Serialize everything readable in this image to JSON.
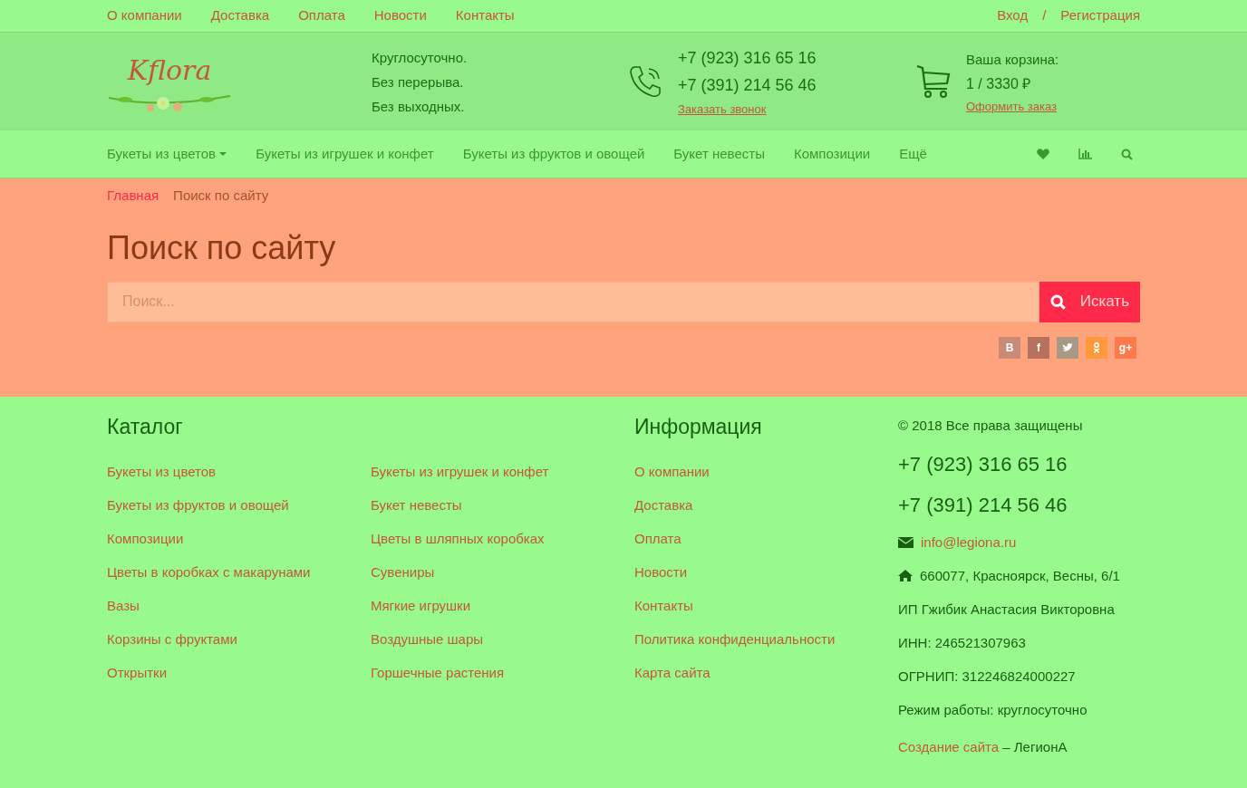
{
  "top_links": [
    "О компании",
    "Доставка",
    "Оплата",
    "Новости",
    "Контакты"
  ],
  "auth": {
    "login": "Вход",
    "separator": "/",
    "register": "Регистрация"
  },
  "logo": {
    "text": "Kflora"
  },
  "schedule": [
    "Круглосуточно.",
    "Без перерыва.",
    "Без выходных."
  ],
  "phones": {
    "numbers": [
      "+7 (923) 316 65 16",
      "+7 (391) 214 56 46"
    ],
    "callback": "Заказать звонок"
  },
  "cart": {
    "label": "Ваша корзина:",
    "summary": "1 / 3330 ₽",
    "checkout": "Оформить заказ"
  },
  "menu": [
    {
      "label": "Букеты из цветов",
      "dropdown": true
    },
    {
      "label": "Букеты из игрушек и конфет",
      "dropdown": false
    },
    {
      "label": "Букеты из фруктов и овощей",
      "dropdown": false
    },
    {
      "label": "Букет невесты",
      "dropdown": false
    },
    {
      "label": "Композиции",
      "dropdown": false
    },
    {
      "label": "Ещё",
      "dropdown": false
    }
  ],
  "breadcrumbs": [
    {
      "label": "Главная",
      "selected": false
    },
    {
      "label": "Поиск по сайту",
      "selected": true
    }
  ],
  "page_title": "Поиск по сайту",
  "search": {
    "placeholder": "Поиск...",
    "button": "Искать"
  },
  "social": [
    {
      "kind": "text",
      "label": "B",
      "color": "#c98a78"
    },
    {
      "kind": "text",
      "label": "f",
      "color": "#b8705f"
    },
    {
      "kind": "bird",
      "color": "#a79a85"
    },
    {
      "kind": "ok",
      "color": "#ff9a3c"
    },
    {
      "kind": "text",
      "label": "g+",
      "color": "#ff7a4a"
    }
  ],
  "footer": {
    "catalog_title": "Каталог",
    "catalog": [
      "Букеты из цветов",
      "Букеты из игрушек и конфет",
      "Букеты из фруктов и овощей",
      "Букет невесты",
      "Композиции",
      "Цветы в шляпных коробках",
      "Цветы в коробках с макарунами",
      "Сувениры",
      "Вазы",
      "Мягкие игрушки",
      "Корзины с фруктами",
      "Воздушные шары",
      "Открытки",
      "Горшечные растения"
    ],
    "info_title": "Информация",
    "info": [
      "О компании",
      "Доставка",
      "Оплата",
      "Новости",
      "Контакты",
      "Политика конфиденциальности",
      "Карта сайта"
    ],
    "copyright": "© 2018 Все права защищены",
    "phones": [
      "+7 (923) 316 65 16",
      "+7 (391) 214 56 46"
    ],
    "email": "info@legiona.ru",
    "address": "660077, Красноярск, Весны, 6/1",
    "details": [
      "ИП Гжибик Анастасия Викторовна",
      "ИНН: 246521307963",
      "ОГРНИП: 312246824000227",
      "Режим работы: круглосуточно"
    ],
    "credit_link": "Создание сайта",
    "credit_text": "– ЛегионА"
  }
}
